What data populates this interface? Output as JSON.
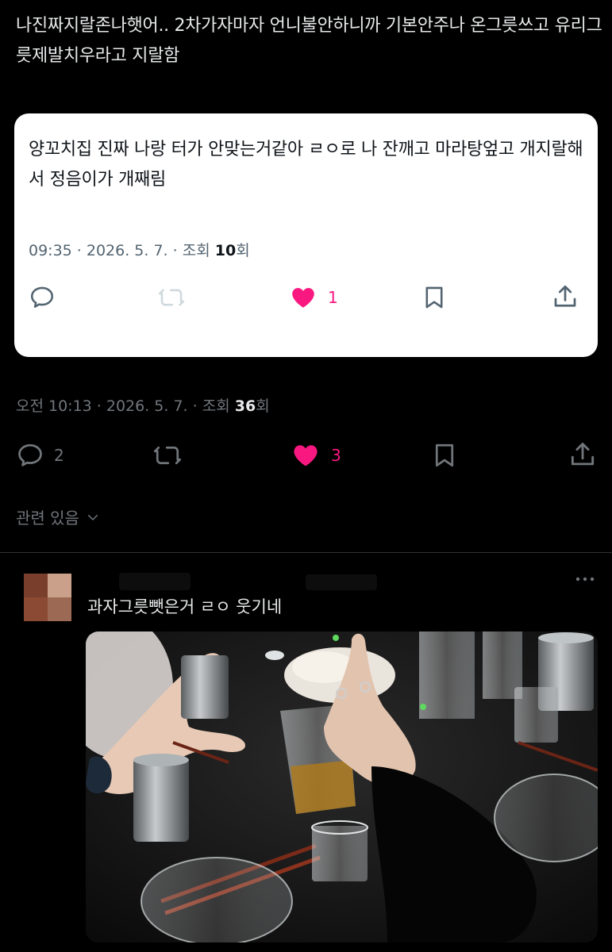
{
  "post": {
    "text": "나진짜지랄존나햇어..  2차가자마자 언니불안하니까 기본안주나 온그릇쓰고 유리그릇제발치우라고 지랄함",
    "time": "오전 10:13 · 2026. 5. 7. · 조회 ",
    "views": "36",
    "views_suffix": "회",
    "replies": "2",
    "likes": "3",
    "icons": [
      "reply-icon",
      "retweet-icon",
      "heart-icon",
      "bookmark-icon",
      "share-icon"
    ]
  },
  "quote": {
    "text": "양꼬치집 진짜 나랑 터가 안맞는거같아 ㄹㅇ로 나 잔깨고 마라탕엎고 개지랄해서 정음이가 개째림",
    "time": "09:35 · 2026. 5. 7. · 조회 ",
    "views": "10",
    "views_suffix": "회",
    "likes": "1"
  },
  "related": {
    "label": "관련 있음"
  },
  "reply": {
    "text": "과자그릇뺏은거 ㄹㅇ 웃기네"
  },
  "colors": {
    "background": "#000000",
    "like": "#f91880",
    "muted": "#71767b",
    "card": "#ffffff"
  }
}
